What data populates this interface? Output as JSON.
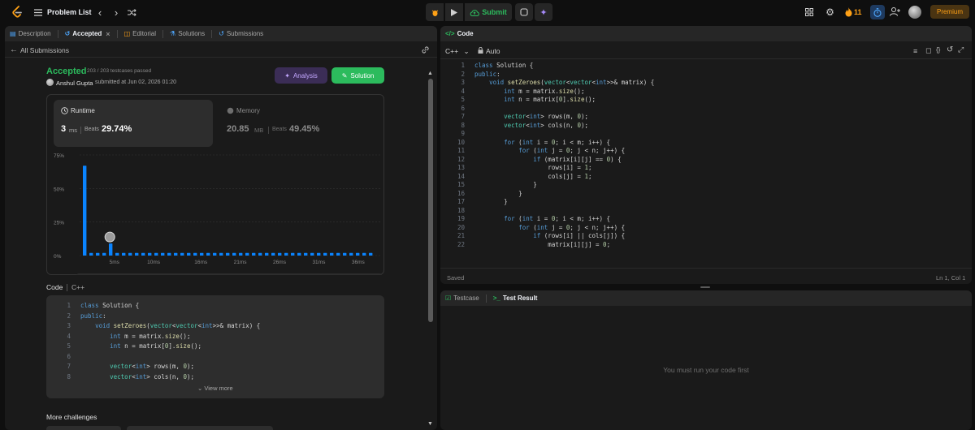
{
  "nav": {
    "problem_list": "Problem List",
    "streak": "11",
    "premium": "Premium",
    "submit": "Submit"
  },
  "tabs": [
    "Description",
    "Accepted",
    "Editorial",
    "Solutions",
    "Submissions"
  ],
  "left": {
    "back": "All Submissions",
    "status": "Accepted",
    "testcases": "203 / 203 testcases passed",
    "author": "Anshul Gupta",
    "submitted": "submitted at Jun 02, 2026 01:20",
    "analysis_btn": "Analysis",
    "solution_btn": "Solution",
    "runtime_label": "Runtime",
    "runtime_value": "3",
    "runtime_unit": "ms",
    "runtime_beats_label": "Beats",
    "runtime_beats": "29.74%",
    "memory_label": "Memory",
    "memory_value": "20.85",
    "memory_unit": "MB",
    "memory_beats_label": "Beats",
    "memory_beats": "49.45%",
    "code_label": "Code",
    "code_lang": "C++",
    "view_more": "View more",
    "more_challenges": "More challenges"
  },
  "chart_data": {
    "type": "bar",
    "yticks": [
      "75%",
      "50%",
      "25%",
      "0%"
    ],
    "ylim": [
      0,
      75
    ],
    "xticks": [
      "5ms",
      "10ms",
      "16ms",
      "21ms",
      "26ms",
      "31ms",
      "36ms"
    ],
    "values": [
      67,
      2,
      2,
      2,
      9,
      2,
      2,
      2,
      2,
      2,
      2,
      2,
      2,
      2,
      2,
      2,
      2,
      2,
      2,
      2,
      2,
      2,
      2,
      2,
      2,
      2,
      2,
      2,
      2,
      2,
      2,
      2,
      2,
      2,
      2,
      2,
      2,
      2,
      2,
      2,
      2,
      2,
      2,
      2,
      2
    ],
    "highlight_index": 4,
    "bar_color": "#0a84ff",
    "grid": true
  },
  "preview_code": [
    "class Solution {",
    "public:",
    "    void setZeroes(vector<vector<int>>& matrix) {",
    "        int m = matrix.size();",
    "        int n = matrix[0].size();",
    "",
    "        vector<int> rows(m, 0);",
    "        vector<int> cols(n, 0);"
  ],
  "editor": {
    "title": "Code",
    "lang": "C++",
    "mode": "Auto",
    "saved": "Saved",
    "cursor": "Ln 1, Col 1",
    "lines": [
      "class Solution {",
      "public:",
      "    void setZeroes(vector<vector<int>>& matrix) {",
      "        int m = matrix.size();",
      "        int n = matrix[0].size();",
      "",
      "        vector<int> rows(m, 0);",
      "        vector<int> cols(n, 0);",
      "",
      "        for (int i = 0; i < m; i++) {",
      "            for (int j = 0; j < n; j++) {",
      "                if (matrix[i][j] == 0) {",
      "                    rows[i] = 1;",
      "                    cols[j] = 1;",
      "                }",
      "            }",
      "        }",
      "",
      "        for (int i = 0; i < m; i++) {",
      "            for (int j = 0; j < n; j++) {",
      "                if (rows[i] || cols[j]) {",
      "                    matrix[i][j] = 0;"
    ]
  },
  "test": {
    "tab1": "Testcase",
    "tab2": "Test Result",
    "empty": "You must run your code first"
  }
}
